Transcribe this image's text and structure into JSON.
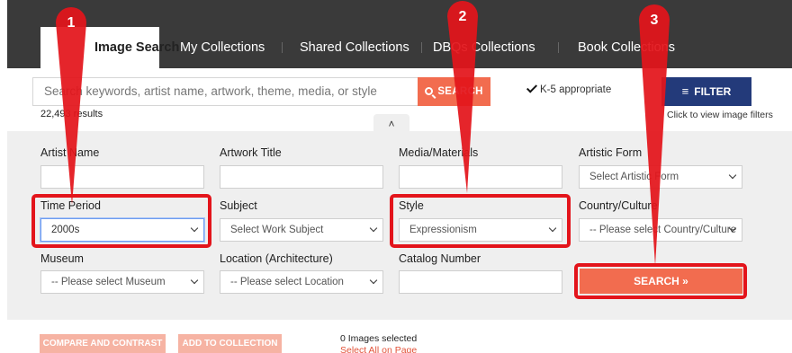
{
  "tabs": [
    {
      "label": "Image Search",
      "active": true
    },
    {
      "label": "My Collections",
      "active": false
    },
    {
      "label": "Shared Collections",
      "active": false
    },
    {
      "label": "DBQs Collections",
      "active": false
    },
    {
      "label": "Book Collections",
      "active": false
    }
  ],
  "search": {
    "placeholder": "Search keywords, artist name, artwork, theme, media, or style",
    "button_label": "SEARCH",
    "results_count": "22,493 results"
  },
  "k5": {
    "label": "K-5 appropriate",
    "checked": true
  },
  "filter": {
    "button_label": "FILTER",
    "hint": "Click to view image filters"
  },
  "collapse": {
    "icon": "double-chevron-up-icon"
  },
  "filters": {
    "artist_name": {
      "label": "Artist Name",
      "value": ""
    },
    "artwork_title": {
      "label": "Artwork Title",
      "value": ""
    },
    "media": {
      "label": "Media/Materials",
      "value": ""
    },
    "artistic_form": {
      "label": "Artistic Form",
      "value": "Select Artistic Form"
    },
    "time_period": {
      "label": "Time Period",
      "value": "2000s"
    },
    "subject": {
      "label": "Subject",
      "value": "Select Work Subject"
    },
    "style": {
      "label": "Style",
      "value": "Expressionism"
    },
    "country": {
      "label": "Country/Culture",
      "value": "-- Please select Country/Culture"
    },
    "museum": {
      "label": "Museum",
      "value": "-- Please select Museum"
    },
    "location": {
      "label": "Location (Architecture)",
      "value": "-- Please select Location"
    },
    "catalog": {
      "label": "Catalog Number",
      "value": ""
    },
    "search_label": "SEARCH »"
  },
  "bottom": {
    "compare_label": "COMPARE AND CONTRAST",
    "add_label": "ADD TO COLLECTION",
    "selected_count": "0 Images selected",
    "select_all": "Select All on Page"
  },
  "annotations": {
    "color": "#e3141b",
    "markers": [
      "1",
      "2",
      "3"
    ]
  }
}
